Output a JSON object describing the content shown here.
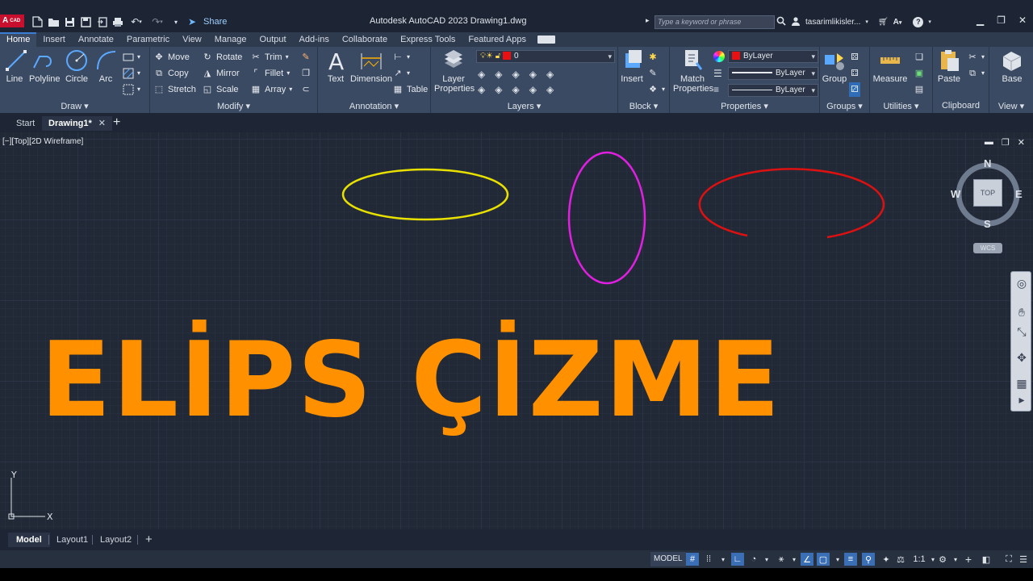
{
  "app": {
    "logo_text": "A",
    "logo_sub": "CAD",
    "share_label": "Share",
    "window_title": "Autodesk AutoCAD 2023    Drawing1.dwg",
    "search_placeholder": "Type a keyword or phrase",
    "user_name": "tasarimlikisler...",
    "help": "?"
  },
  "ribbon_tabs": [
    "Home",
    "Insert",
    "Annotate",
    "Parametric",
    "View",
    "Manage",
    "Output",
    "Add-ins",
    "Collaborate",
    "Express Tools",
    "Featured Apps"
  ],
  "ribbon": {
    "draw": {
      "title": "Draw",
      "line": "Line",
      "polyline": "Polyline",
      "circle": "Circle",
      "arc": "Arc"
    },
    "modify": {
      "title": "Modify",
      "move": "Move",
      "rotate": "Rotate",
      "trim": "Trim",
      "copy": "Copy",
      "mirror": "Mirror",
      "fillet": "Fillet",
      "stretch": "Stretch",
      "scale": "Scale",
      "array": "Array"
    },
    "annotation": {
      "title": "Annotation",
      "text": "Text",
      "dimension": "Dimension",
      "table": "Table"
    },
    "layers": {
      "title": "Layers",
      "layer_properties_1": "Layer",
      "layer_properties_2": "Properties",
      "current_layer": "0"
    },
    "block": {
      "title": "Block",
      "insert": "Insert"
    },
    "properties": {
      "title": "Properties",
      "match_1": "Match",
      "match_2": "Properties",
      "color": "ByLayer",
      "linetype": "ByLayer",
      "lineweight": "ByLayer"
    },
    "groups": {
      "title": "Groups",
      "group": "Group"
    },
    "utilities": {
      "title": "Utilities",
      "measure": "Measure"
    },
    "clipboard": {
      "title": "Clipboard",
      "paste": "Paste"
    },
    "view": {
      "title": "View",
      "base": "Base"
    }
  },
  "file_tabs": {
    "start": "Start",
    "drawing": "Drawing1*",
    "close": "✕",
    "add": "+"
  },
  "viewport": {
    "label": "[−][Top][2D Wireframe]",
    "controls": [
      "▬",
      "❐",
      "✕"
    ],
    "title_text": "ELİPS ÇİZME",
    "viewcube": {
      "face": "TOP",
      "n": "N",
      "s": "S",
      "e": "E",
      "w": "W",
      "wcs": "WCS"
    },
    "ucs": {
      "x": "X",
      "y": "Y"
    },
    "ellipses": [
      {
        "name": "yellow-ellipse",
        "color": "#e8e000"
      },
      {
        "name": "magenta-ellipse",
        "color": "#e020e0"
      },
      {
        "name": "red-elliptical-arc",
        "color": "#dd1111"
      }
    ]
  },
  "layout_tabs": {
    "model": "Model",
    "layout1": "Layout1",
    "layout2": "Layout2",
    "add": "+"
  },
  "status_bar": {
    "model": "MODEL",
    "scale": "1:1"
  },
  "colors": {
    "accent_orange": "#ff9000",
    "title_bar": "#1d2535",
    "ribbon": "#3b4a63"
  }
}
